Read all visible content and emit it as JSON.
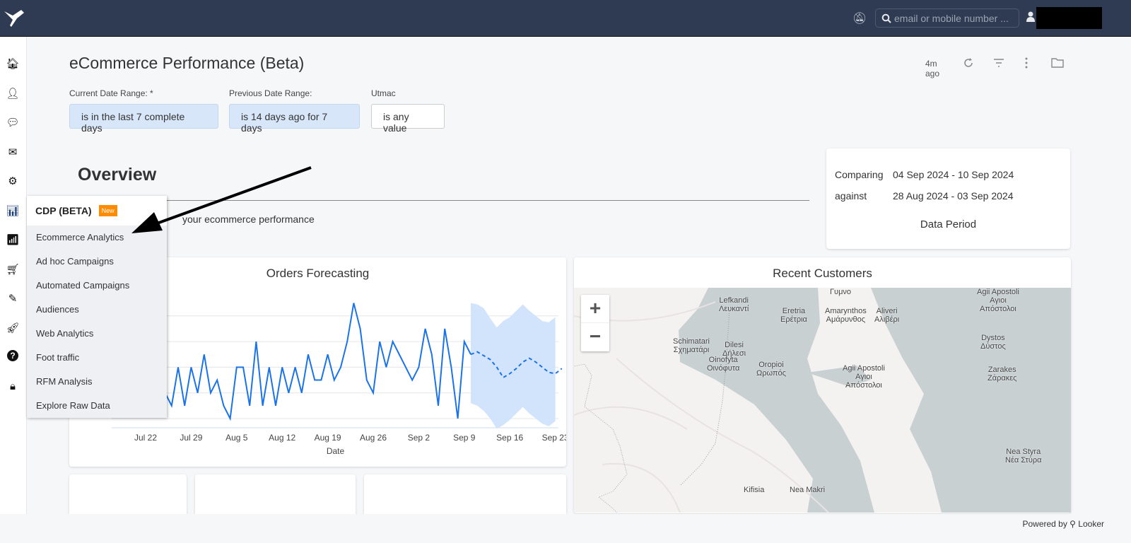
{
  "topbar": {
    "search_placeholder": "email or mobile number ...",
    "icons": [
      "bird-logo",
      "bell-slash-icon",
      "search-icon",
      "user-icon"
    ]
  },
  "nav": {
    "icons": [
      "home-icon",
      "user-icon",
      "comments-icon",
      "envelope-icon",
      "cogs-icon",
      "bar-chart-icon",
      "signal-icon",
      "cart-icon",
      "edit-icon",
      "rocket-icon",
      "question-icon",
      "lock-icon"
    ]
  },
  "header": {
    "title": "eCommerce Performance (Beta)",
    "updated": "4m ago"
  },
  "filters": [
    {
      "label": "Current Date Range: *",
      "value": "is in the last 7 complete days"
    },
    {
      "label": "Previous Date Range:",
      "value": "is 14 days ago for 7 days"
    },
    {
      "label": "Utmac",
      "value": "is any value"
    }
  ],
  "overview": {
    "title": "Overview",
    "subtitle": "your ecommerce performance"
  },
  "period": {
    "comparing_label": "Comparing",
    "comparing_value": "04 Sep 2024 - 10 Sep 2024",
    "against_label": "against",
    "against_value": "28 Aug 2024 - 03 Sep 2024",
    "footer": "Data Period"
  },
  "menu": {
    "title": "CDP (BETA)",
    "badge": "New",
    "items": [
      "Ecommerce Analytics",
      "Ad hoc Campaigns",
      "Automated Campaigns",
      "Audiences",
      "Web Analytics",
      "Foot traffic",
      "RFM Analysis",
      "Explore Raw Data"
    ]
  },
  "map": {
    "title": "Recent Customers",
    "zoom_in": "+",
    "zoom_out": "−",
    "places": [
      "Lefkandi\nΛευκαντί",
      "Eretria\nΕρέτρια",
      "Amarynthos\nΑμάρυνθος",
      "Aliveri\nΑλιβέρι",
      "Agii Apostoli\nΑγιοι\nΑπόστολοι",
      "Dystos\nΔύστος",
      "Schimatari\nΣχηματάρι",
      "Dilesi\nΔήλεσι",
      "Oinofyta\nΟινόφυτα",
      "Oropioi\nΩρωπός",
      "Agii Apostoli\nΑγιοι\nΑπόστολοι",
      "Zarakes\nΖάρακες",
      "Nea Styra\nΝέα Στύρα",
      "Kifisia",
      "Nea Makri",
      "Γυμνο"
    ]
  },
  "footer": {
    "powered": "Powered by ⚲ Looker"
  },
  "chart_data": {
    "type": "line",
    "title": "Orders Forecasting",
    "xlabel": "Date",
    "ylabel": "",
    "x_ticks": [
      "Jul 22",
      "Jul 29",
      "Aug 5",
      "Aug 12",
      "Aug 19",
      "Aug 26",
      "Sep 2",
      "Sep 9",
      "Sep 16",
      "Sep 23"
    ],
    "grid": true,
    "color": "#1a73e8",
    "band_color": "#d2e3fc",
    "actual_start": "2024-07-25",
    "actual": [
      2,
      1.5,
      3,
      1.5,
      3,
      2,
      3.5,
      2,
      2.5,
      1.5,
      1,
      3,
      3,
      1.5,
      4,
      1.5,
      3,
      1.5,
      3,
      2,
      3,
      2,
      3.5,
      2.5,
      2.5,
      3.5,
      2.5,
      3,
      4,
      5.5,
      4.5,
      2.5,
      2,
      4,
      3,
      4,
      3.5,
      3,
      2.5,
      3,
      4.5,
      3.5,
      1.5,
      4.5,
      3,
      1,
      4,
      3.5
    ],
    "forecast_start": "2024-09-11",
    "forecast": [
      3.6,
      3.45,
      3.3,
      3.0,
      2.6,
      2.75,
      2.95,
      3.2,
      3.35,
      3.2,
      3.0,
      2.8,
      2.75,
      2.95
    ],
    "forecast_upper": [
      5.5,
      5.45,
      5.3,
      4.9,
      4.55,
      4.8,
      4.95,
      5.2,
      5.45,
      5.2,
      5.0,
      4.8,
      4.75,
      4.95
    ],
    "forecast_lower": [
      1.6,
      1.5,
      1.3,
      1.0,
      0.6,
      0.75,
      0.95,
      1.2,
      1.45,
      1.2,
      1.0,
      0.8,
      0.7,
      0.9
    ]
  }
}
